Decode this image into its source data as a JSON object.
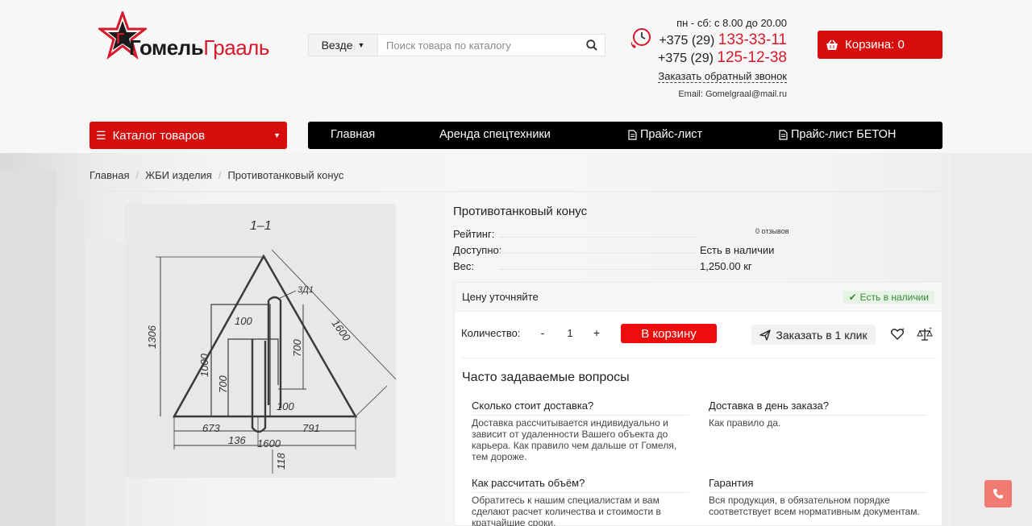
{
  "brand": {
    "logo_part1": "Гомель",
    "logo_part2": "Грааль",
    "colors": {
      "accent": "#d70d0d",
      "logo_red": "#d7192b",
      "nav_bg": "#000000",
      "stock_green": "#3a8a3a"
    }
  },
  "search": {
    "scope_label": "Везде",
    "placeholder": "Поиск товара по каталогу",
    "icon": "search-icon"
  },
  "contacts": {
    "hours": "пн - сб: с 8.00 до 20.00",
    "phone1_prefix": "+375 (29)",
    "phone1_number": "133-33-11",
    "phone2_prefix": "+375 (29)",
    "phone2_number": "125-12-38",
    "callback_label": "Заказать обратный звонок",
    "email": "Email: Gomelgraal@mail.ru",
    "icon": "clock-phone-icon"
  },
  "cart": {
    "label": "Корзина: 0",
    "icon": "basket-icon"
  },
  "catalog_menu": {
    "label": "Каталог товаров",
    "icon": "burger-icon"
  },
  "nav": {
    "items": [
      {
        "label": "Главная"
      },
      {
        "label": "Аренда спецтехники"
      },
      {
        "label": "Прайс-лист",
        "icon": "document-icon"
      },
      {
        "label": "Прайс-лист БЕТОН",
        "icon": "document-icon"
      }
    ]
  },
  "breadcrumb": {
    "items": [
      "Главная",
      "ЖБИ изделия",
      "Противотанковый конус"
    ]
  },
  "product": {
    "title": "Противотанковый конус",
    "rating_label": "Рейтинг:",
    "reviews": "0 отзывов",
    "availability_label": "Доступно:",
    "availability_value": "Есть в наличии",
    "weight_label": "Вес:",
    "weight_value": "1,250.00 кг",
    "drawing": {
      "section": "1–1",
      "dims": [
        "1306",
        "1600",
        "1000",
        "700",
        "100",
        "700",
        "100",
        "3Д1",
        "673",
        "791",
        "136",
        "1600",
        "118"
      ]
    }
  },
  "buybox": {
    "price_note": "Цену уточняйте",
    "stock_badge": "Есть в наличии",
    "qty_label": "Количество:",
    "qty_minus": "-",
    "qty_value": "1",
    "qty_plus": "+",
    "add_to_cart": "В корзину",
    "one_click": "Заказать в 1 клик"
  },
  "faq": {
    "title": "Часто задаваемые вопросы",
    "items": [
      {
        "q": "Сколько стоит доставка?",
        "a": "Доставка рассчитывается индивидуально и зависит от удаленности Вашего объекта до карьера. Как правило чем дальше от Гомеля, тем дороже."
      },
      {
        "q": "Доставка в день заказа?",
        "a": "Как правило да."
      },
      {
        "q": "Как рассчитать объём?",
        "a": "Обратитесь к нашим специалистам и вам сделают расчет количества и стоимости в кратчайшие сроки."
      },
      {
        "q": "Гарантия",
        "a": "Вся продукция, в обязательном порядке соответствует всем нормативным документам."
      }
    ]
  },
  "float_call": {
    "icon": "phone-icon"
  }
}
